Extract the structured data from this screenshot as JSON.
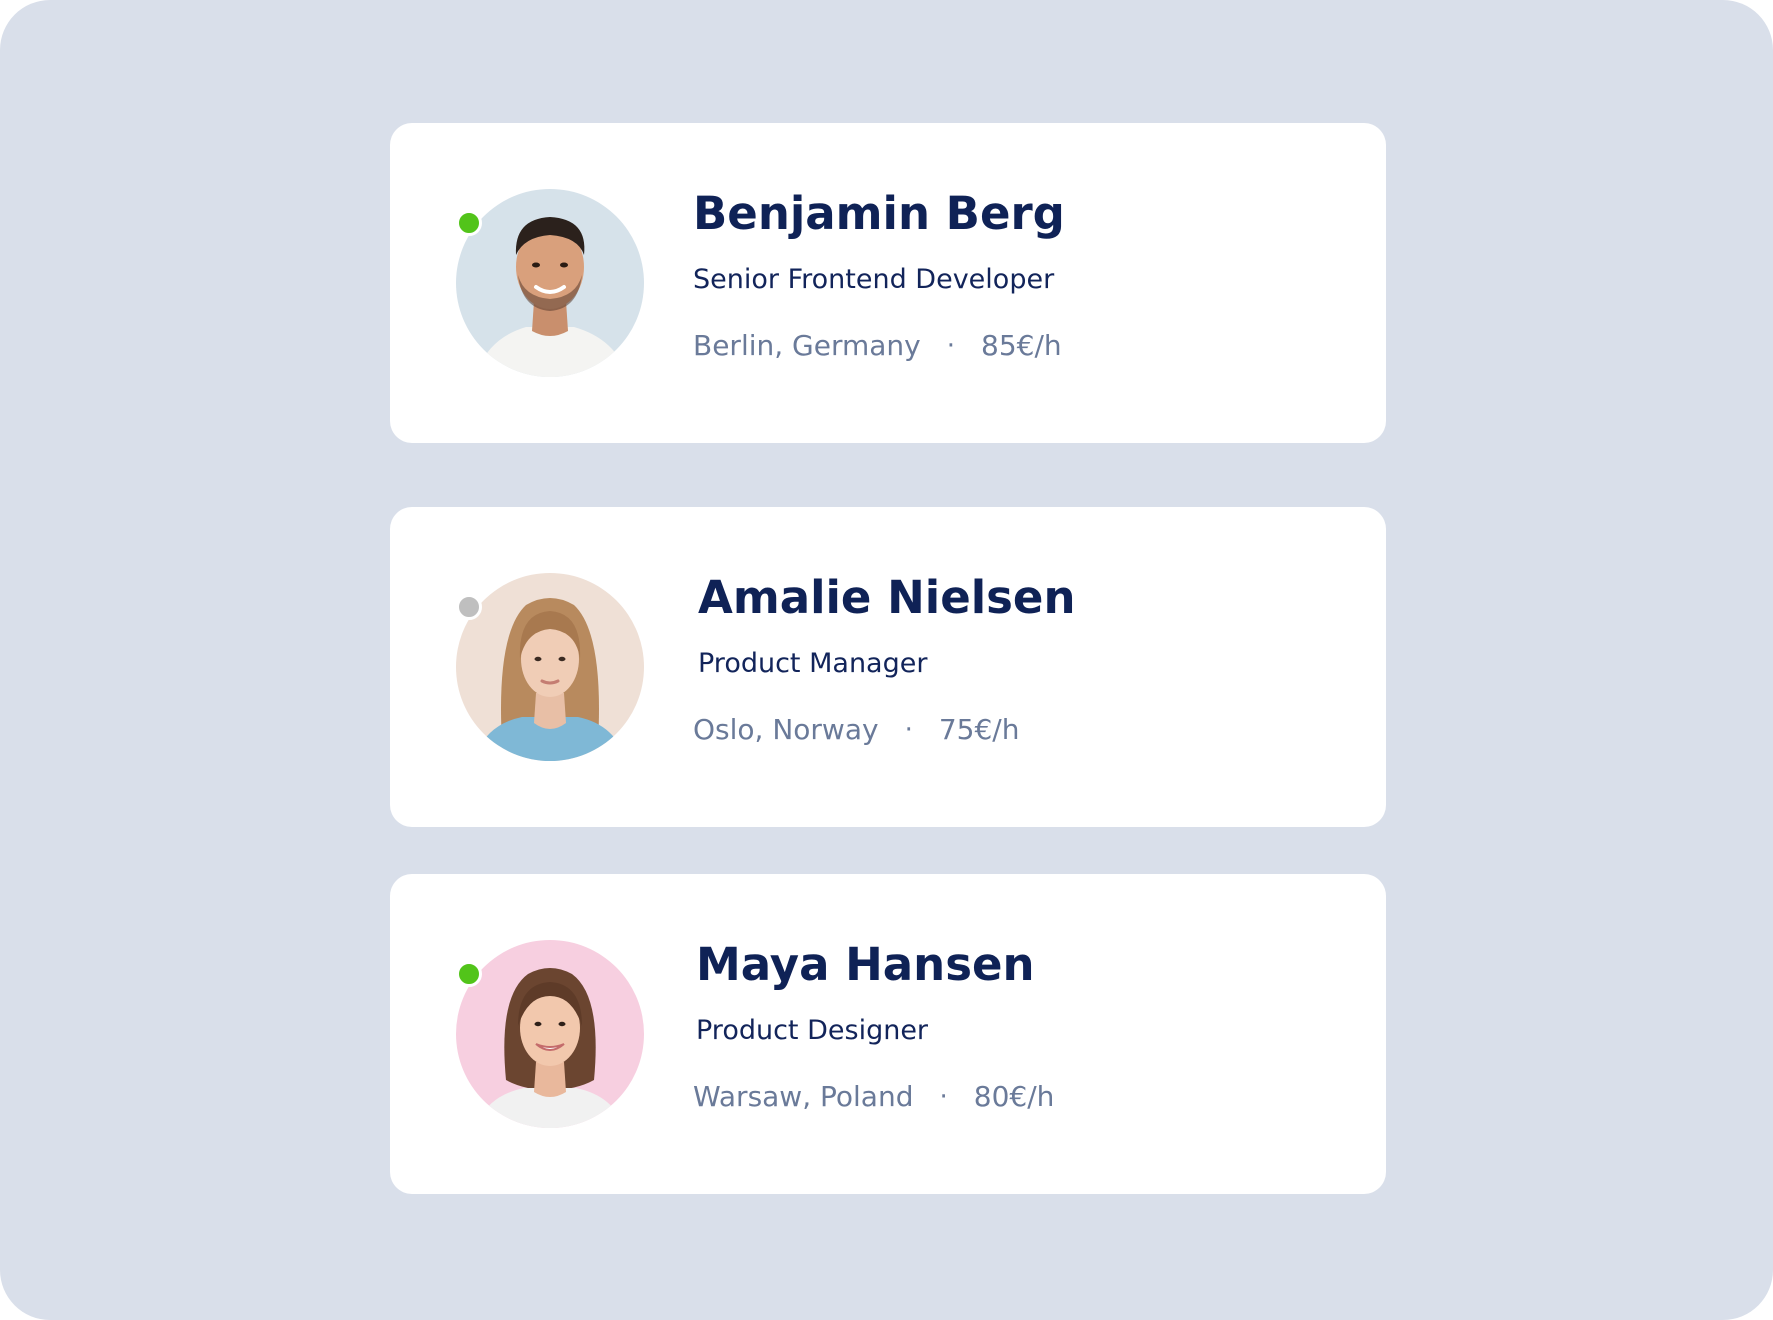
{
  "profiles": [
    {
      "name": "Benjamin Berg",
      "role": "Senior Frontend Developer",
      "location": "Berlin, Germany",
      "rate": "85€/h",
      "separator": "·",
      "status": "online",
      "status_color": "#52c41a",
      "avatar_bg": "#d6e2ea"
    },
    {
      "name": "Amalie Nielsen",
      "role": "Product Manager",
      "location": "Oslo, Norway",
      "rate": "75€/h",
      "separator": "·",
      "status": "offline",
      "status_color": "#bfbfbf",
      "avatar_bg": "#efe0d6"
    },
    {
      "name": "Maya Hansen",
      "role": "Product Designer",
      "location": "Warsaw, Poland",
      "rate": "80€/h",
      "separator": "·",
      "status": "online",
      "status_color": "#52c41a",
      "avatar_bg": "#f7cfe0"
    }
  ],
  "colors": {
    "page_background": "#d9dfea",
    "card_background": "#ffffff",
    "name_text": "#0f2256",
    "meta_text": "#6a7a99"
  }
}
